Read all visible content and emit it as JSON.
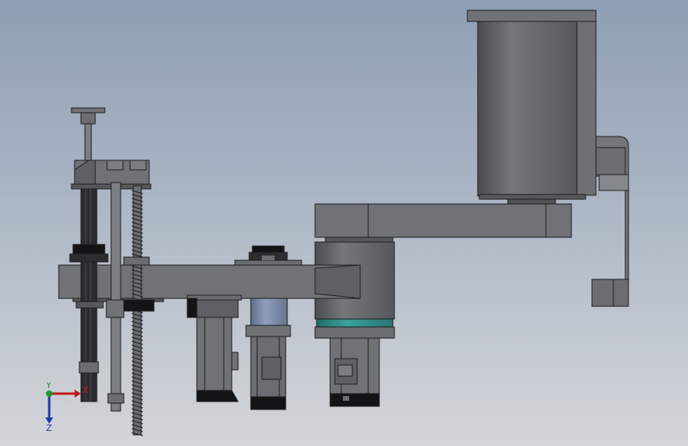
{
  "viewport": {
    "background_top": "#8f9fb3",
    "background_bottom": "#d3d6da"
  },
  "model": {
    "body_color": "#6b6e72",
    "dark_color": "#3c3e41",
    "edge_color": "#1e1f21",
    "black_color": "#0f0f10",
    "accent_ring_color": "#2f8a87",
    "motor_blue_color": "#7a8aa6"
  },
  "triad": {
    "x_label": "X",
    "y_label": "Y",
    "z_label": "Z",
    "x_color": "#c0191c",
    "y_color": "#1b9a2c",
    "z_color": "#1f3aa8"
  }
}
